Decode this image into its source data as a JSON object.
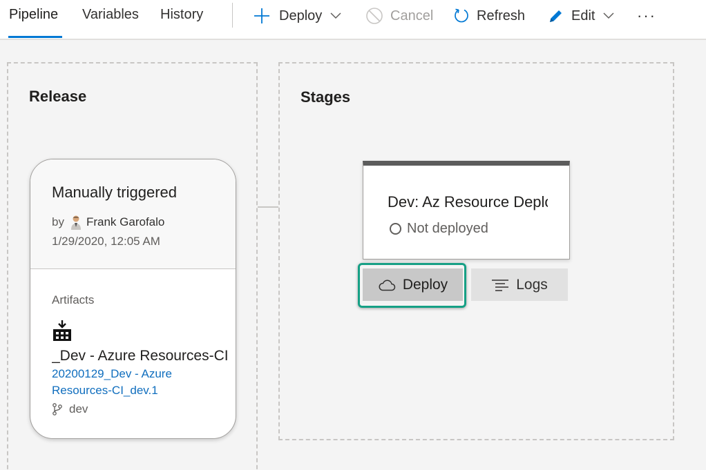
{
  "tabs": [
    {
      "label": "Pipeline",
      "active": true
    },
    {
      "label": "Variables",
      "active": false
    },
    {
      "label": "History",
      "active": false
    }
  ],
  "toolbar": {
    "deploy_label": "Deploy",
    "cancel_label": "Cancel",
    "refresh_label": "Refresh",
    "edit_label": "Edit",
    "more_label": "···"
  },
  "release_panel": {
    "title": "Release",
    "card": {
      "trigger": "Manually triggered",
      "by_label": "by",
      "author": "Frank Garofalo",
      "date": "1/29/2020, 12:05 AM",
      "artifacts_label": "Artifacts",
      "artifact_name": "_Dev - Azure Resources-CI",
      "artifact_version": "20200129_Dev - Azure Resources-CI_dev.1",
      "branch": "dev"
    }
  },
  "stages_panel": {
    "title": "Stages",
    "stage": {
      "name": "Dev: Az Resource Deployment",
      "status": "Not deployed",
      "deploy_label": "Deploy",
      "logs_label": "Logs"
    }
  },
  "colors": {
    "accent": "#0078d4",
    "link": "#106ebe",
    "highlight": "#16a085"
  }
}
